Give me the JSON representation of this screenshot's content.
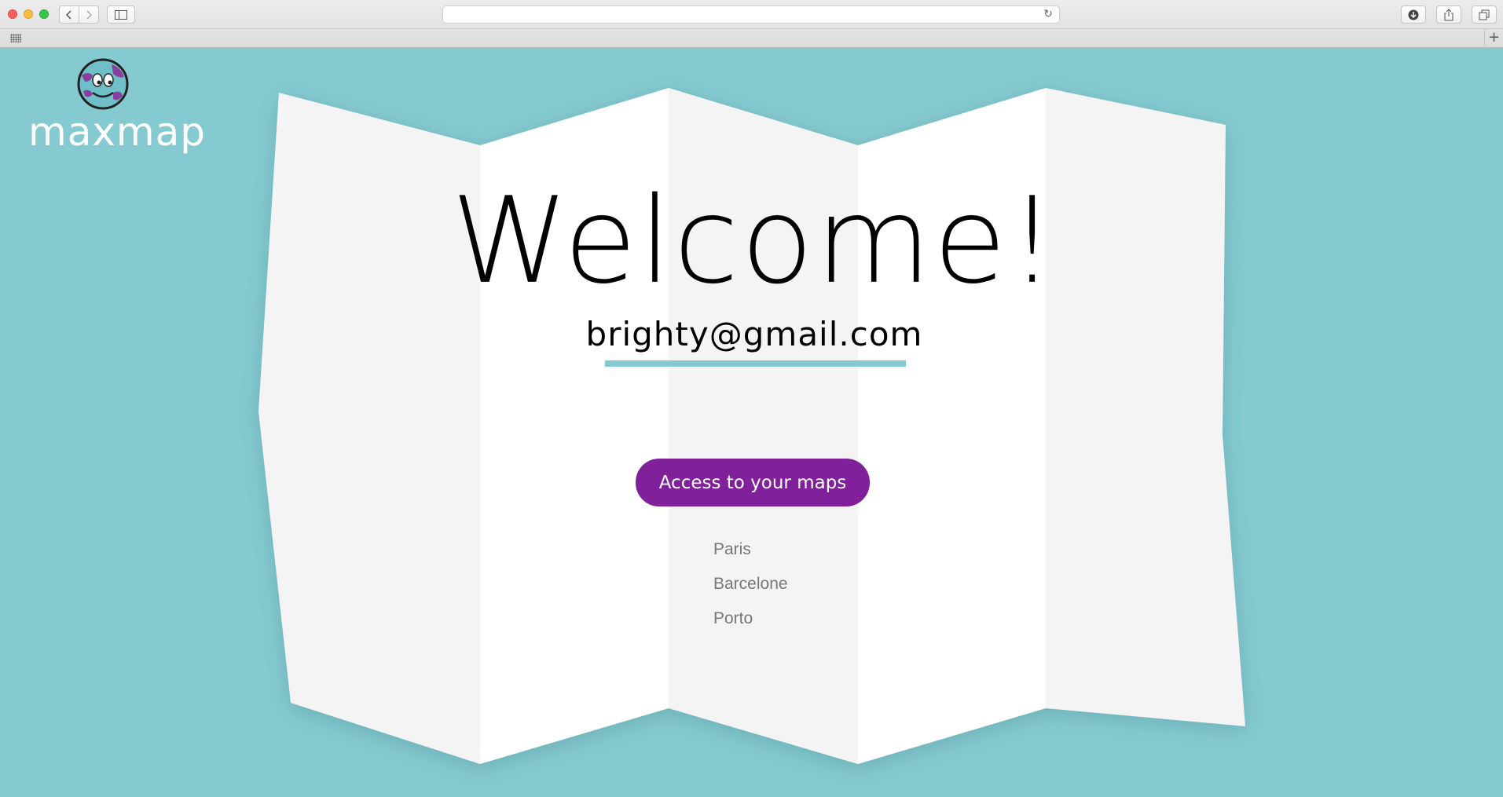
{
  "browser": {
    "address_value": "",
    "reload_glyph": "↻",
    "newtab_glyph": "+"
  },
  "logo": {
    "text": "maxmap",
    "colors": {
      "globe_fill": "#6fbfc8",
      "globe_spots": "#8a3fa0",
      "outline": "#222222"
    }
  },
  "main": {
    "title": "Welcome!",
    "email": "brighty@gmail.com",
    "cta_label": "Access to your maps",
    "maps": [
      "Paris",
      "Barcelone",
      "Porto"
    ]
  },
  "colors": {
    "background": "#86cad1",
    "accent": "#80209a",
    "underline": "#86cad1",
    "paper_light": "#ffffff",
    "paper_shade": "#f4f4f4",
    "list_text": "#777777"
  }
}
